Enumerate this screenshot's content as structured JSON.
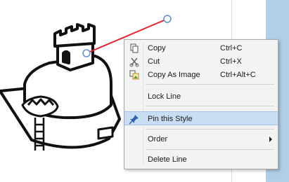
{
  "canvas": {
    "connector_color": "#e8202a",
    "handle_color": "#5d8fd8"
  },
  "context_menu": {
    "items": [
      {
        "label": "Copy",
        "shortcut": "Ctrl+C",
        "icon": "copy-icon"
      },
      {
        "label": "Cut",
        "shortcut": "Ctrl+X",
        "icon": "scissors-icon"
      },
      {
        "label": "Copy As Image",
        "shortcut": "Ctrl+Alt+C",
        "icon": "copy-image-icon"
      },
      {
        "label": "Lock Line"
      },
      {
        "label": "Pin this Style",
        "icon": "pin-icon",
        "highlighted": true
      },
      {
        "label": "Order",
        "submenu": true
      },
      {
        "label": "Delete Line"
      }
    ],
    "highlight_color": "#c9def5"
  }
}
